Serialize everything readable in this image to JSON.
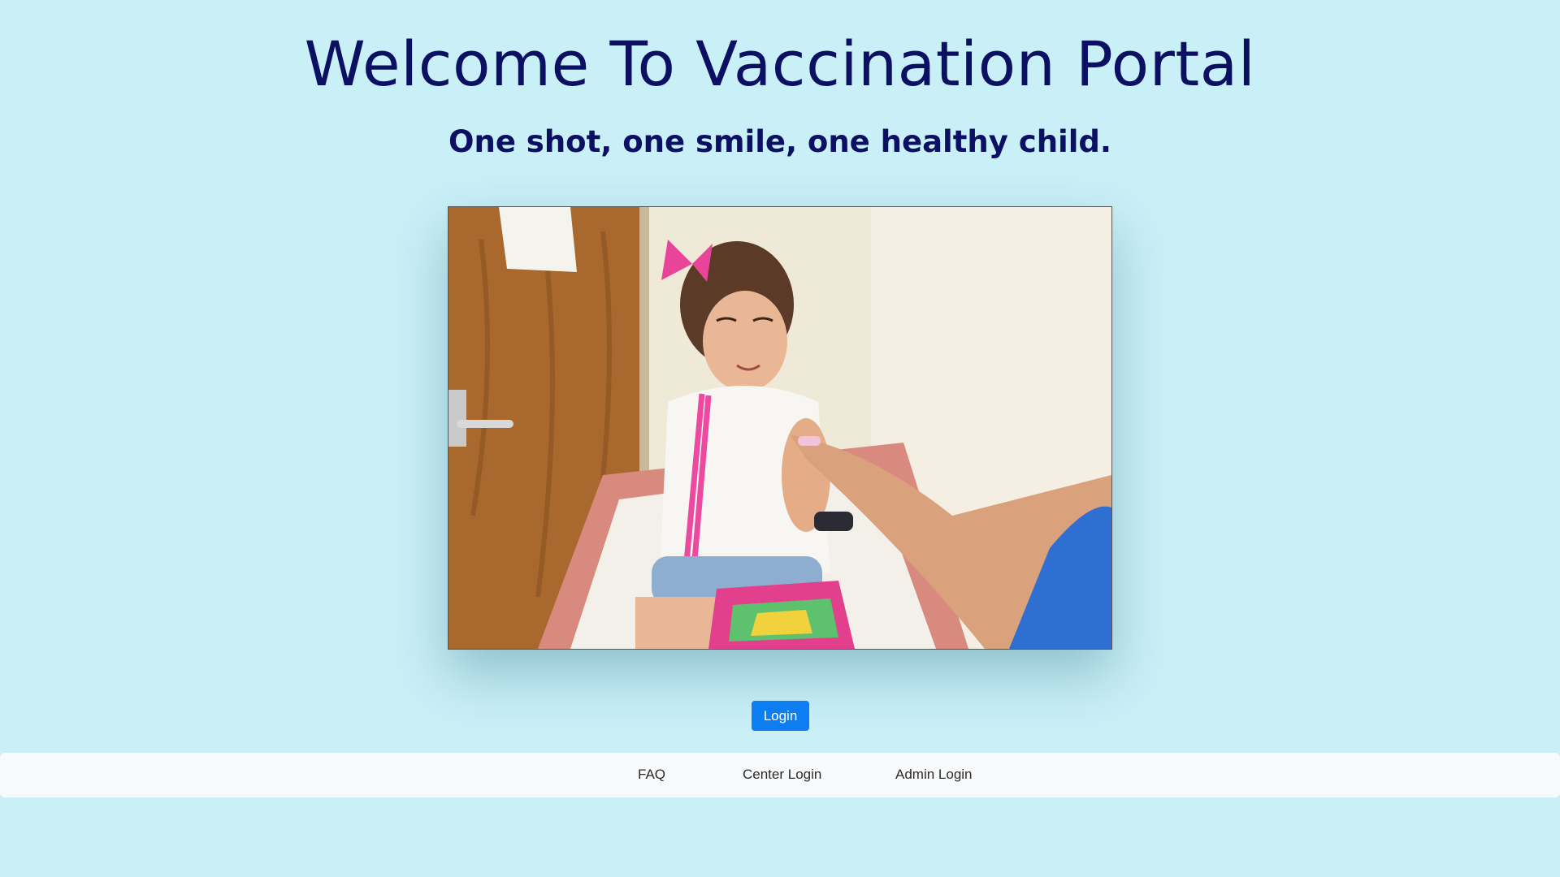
{
  "header": {
    "title": "Welcome To Vaccination Portal",
    "tagline": "One shot, one smile, one healthy child."
  },
  "hero_image": {
    "subject": "child-receiving-bandage-after-vaccination"
  },
  "actions": {
    "login_label": "Login",
    "login_color": "#0d7df2"
  },
  "footer": {
    "links": [
      {
        "label": "FAQ"
      },
      {
        "label": "Center Login"
      },
      {
        "label": "Admin Login"
      }
    ]
  },
  "colors": {
    "background": "#c9eff7",
    "heading": "#0b1063",
    "footer_bg": "#f8f9fa"
  }
}
